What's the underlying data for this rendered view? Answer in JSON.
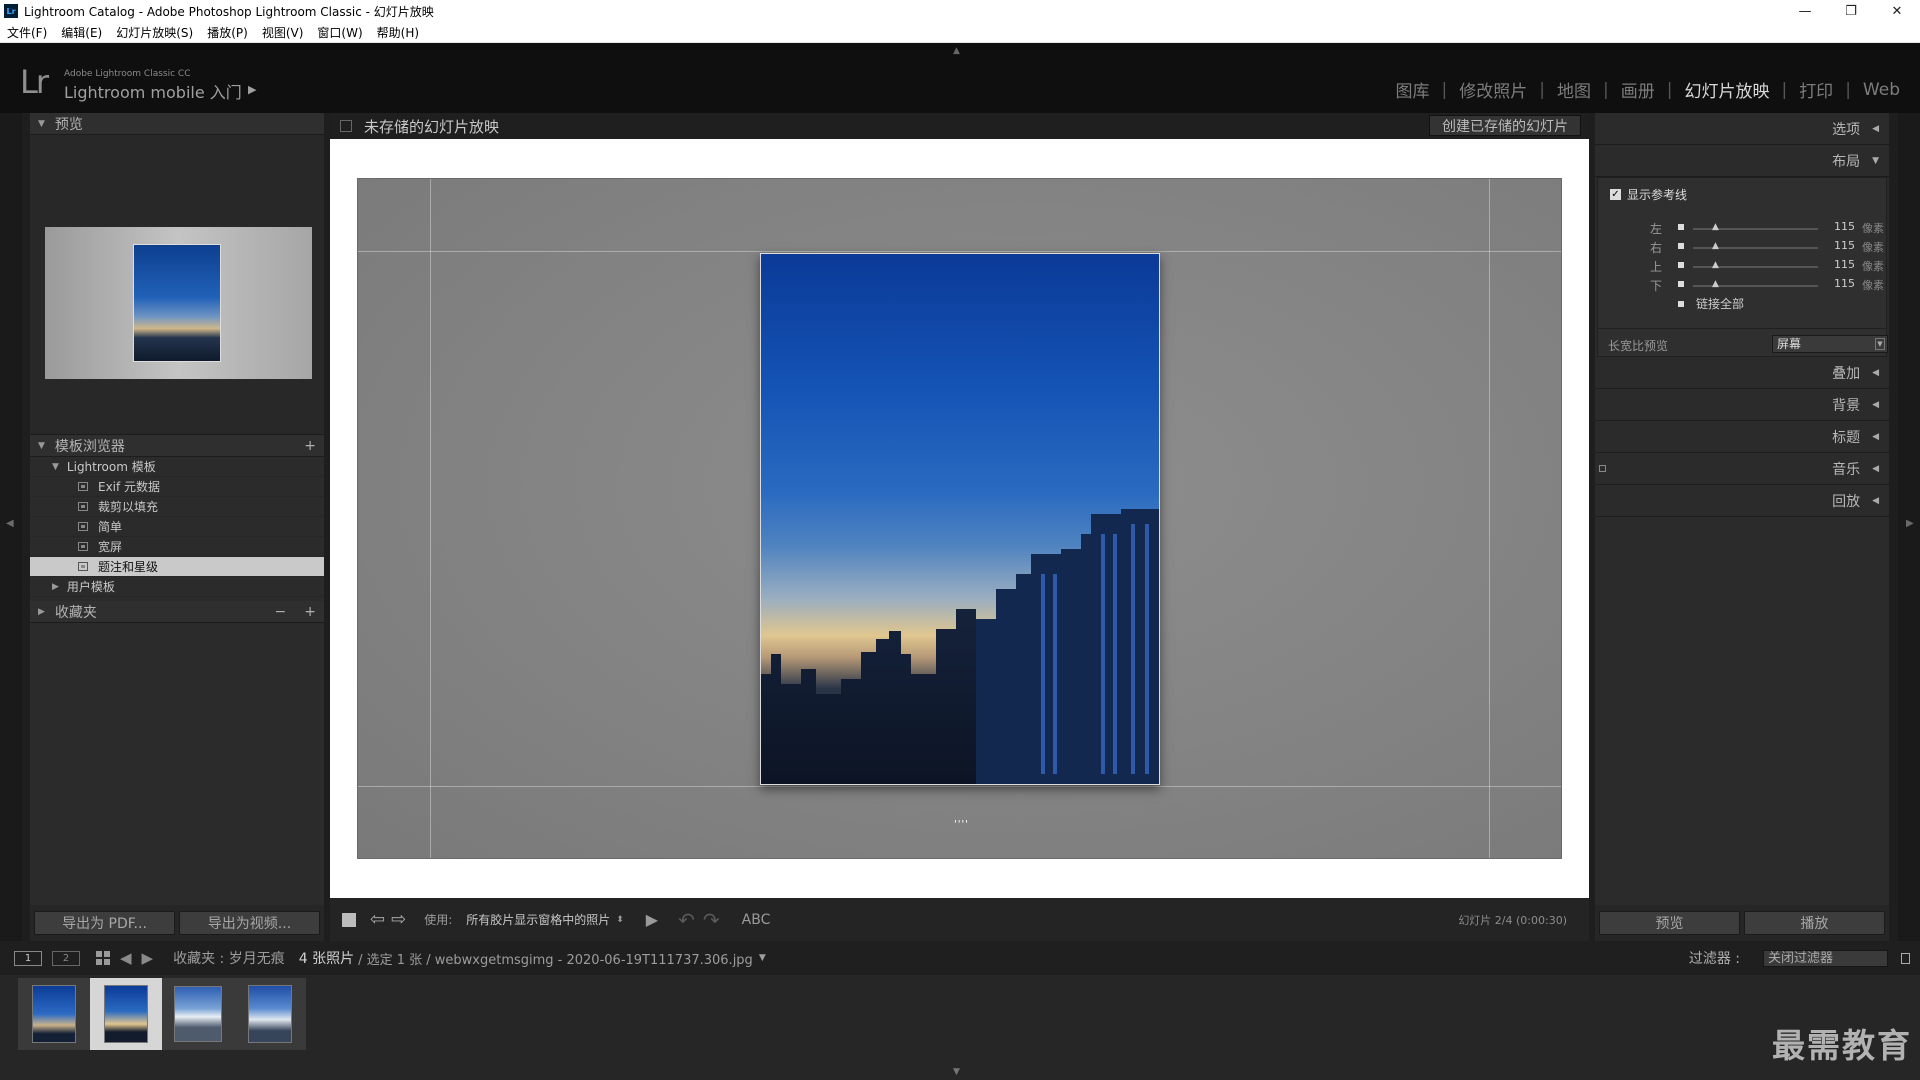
{
  "window": {
    "app_icon": "Lr",
    "title": "Lightroom Catalog - Adobe Photoshop Lightroom Classic - 幻灯片放映",
    "controls": {
      "minimize": "—",
      "restore": "❐",
      "close": "✕"
    }
  },
  "menu": [
    "文件(F)",
    "编辑(E)",
    "幻灯片放映(S)",
    "播放(P)",
    "视图(V)",
    "窗口(W)",
    "帮助(H)"
  ],
  "identity": {
    "logo": "Lr",
    "small": "Adobe Lightroom Classic CC",
    "big": "Lightroom mobile 入门",
    "arrow": "▶"
  },
  "modules": [
    {
      "label": "图库",
      "active": false
    },
    {
      "label": "修改照片",
      "active": false
    },
    {
      "label": "地图",
      "active": false
    },
    {
      "label": "画册",
      "active": false
    },
    {
      "label": "幻灯片放映",
      "active": true
    },
    {
      "label": "打印",
      "active": false
    },
    {
      "label": "Web",
      "active": false
    }
  ],
  "left_panel": {
    "preview_header": "预览",
    "template_header": "模板浏览器",
    "template_add": "+",
    "templates": {
      "group_lr": "Lightroom 模板",
      "items": [
        "Exif 元数据",
        "裁剪以填充",
        "简单",
        "宽屏",
        "题注和星级"
      ],
      "selected_index": 4,
      "group_user": "用户模板"
    },
    "collections_header": "收藏夹",
    "collections_ctrl": [
      "−",
      "+"
    ],
    "export_pdf": "导出为 PDF...",
    "export_video": "导出为视频..."
  },
  "center": {
    "title": "未存储的幻灯片放映",
    "create_button": "创建已存储的幻灯片",
    "slide_rating": "''''"
  },
  "toolbar": {
    "use_label": "使用:",
    "use_value": "所有胶片显示窗格中的照片",
    "abc": "ABC",
    "status": "幻灯片 2/4 (0:00:30)"
  },
  "right_panel": {
    "sections": {
      "options": "选项",
      "layout": "布局",
      "overlay": "叠加",
      "backdrop": "背景",
      "titles": "标题",
      "music": "音乐",
      "playback": "回放"
    },
    "show_guides": "显示参考线",
    "show_guides_checked": true,
    "margins": [
      {
        "label": "左",
        "value": "115",
        "unit": "像素"
      },
      {
        "label": "右",
        "value": "115",
        "unit": "像素"
      },
      {
        "label": "上",
        "value": "115",
        "unit": "像素"
      },
      {
        "label": "下",
        "value": "115",
        "unit": "像素"
      }
    ],
    "link_all": "链接全部",
    "aspect_label": "长宽比预览",
    "aspect_value": "屏幕",
    "preview_button": "预览",
    "play_button": "播放"
  },
  "filmstrip_bar": {
    "monitor1": "1",
    "monitor2": "2",
    "collection": "收藏夹 : 岁月无痕",
    "count": "4 张照片",
    "selection": "/ 选定 1 张 / webwxgetmsgimg - 2020-06-19T111737.306.jpg",
    "filter_label": "过滤器 :",
    "filter_value": "关闭过滤器"
  },
  "watermark": "最需教育",
  "colors": {
    "background": "#1e1e1e",
    "panel": "#2b2b2b",
    "active_module": "#d8d8d8",
    "stage": "#ffffff",
    "slide": "#828282"
  }
}
